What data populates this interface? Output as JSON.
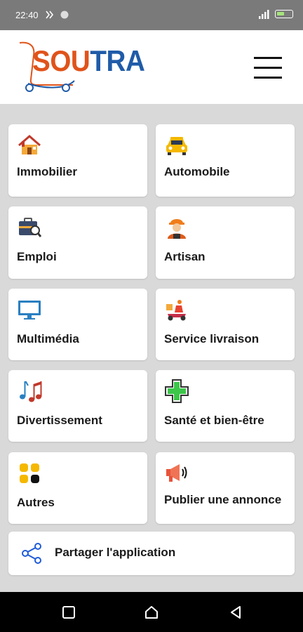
{
  "status_bar": {
    "time": "22:40",
    "icons": [
      "notification-icon",
      "circle-icon",
      "signal-icon",
      "battery-icon"
    ]
  },
  "header": {
    "logo_part1": "SOU",
    "logo_part2": "TRA",
    "menu_icon": "hamburger-menu-icon"
  },
  "categories": [
    {
      "label": "Immobilier",
      "icon": "house-icon"
    },
    {
      "label": "Automobile",
      "icon": "car-icon"
    },
    {
      "label": "Emploi",
      "icon": "briefcase-icon"
    },
    {
      "label": "Artisan",
      "icon": "worker-icon"
    },
    {
      "label": "Multimédia",
      "icon": "monitor-icon"
    },
    {
      "label": "Service livraison",
      "icon": "delivery-scooter-icon"
    },
    {
      "label": "Divertissement",
      "icon": "music-notes-icon"
    },
    {
      "label": "Santé et bien-être",
      "icon": "medical-cross-icon"
    },
    {
      "label": "Autres",
      "icon": "four-dots-icon"
    },
    {
      "label": "Publier une annonce",
      "icon": "megaphone-icon"
    }
  ],
  "share": {
    "label": "Partager l'application",
    "icon": "share-icon"
  },
  "nav": {
    "icons": [
      "recent-apps-icon",
      "home-icon",
      "back-icon"
    ]
  },
  "colors": {
    "logo_orange": "#e0531a",
    "logo_blue": "#1f5ba8",
    "background": "#d9d9d9",
    "status_bar": "#7a7a7a"
  }
}
